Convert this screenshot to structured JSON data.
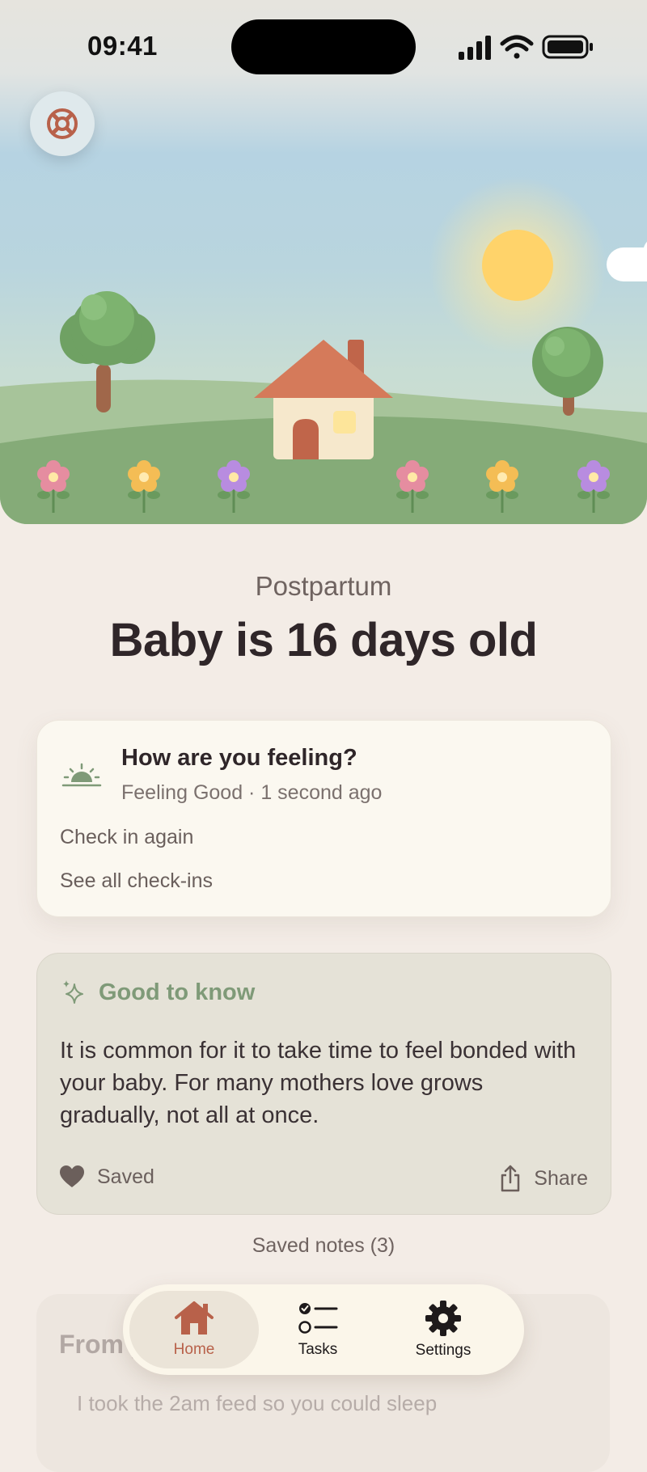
{
  "status_bar": {
    "time": "09:41"
  },
  "hero": {
    "help_label": "Help"
  },
  "header": {
    "phase": "Postpartum",
    "headline": "Baby is 16 days old"
  },
  "feeling_card": {
    "title": "How are you feeling?",
    "status": "Feeling Good · 1 second ago",
    "check_in_label": "Check in again",
    "see_all_label": "See all check-ins"
  },
  "tip_card": {
    "title": "Good to know",
    "body": "It is common for it to take time to feel bonded with your baby. For many mothers love grows gradually, not all at once.",
    "saved_label": "Saved",
    "share_label": "Share"
  },
  "saved_notes_label": "Saved notes (3)",
  "partner_card": {
    "title": "From your partner",
    "quote": "I took the 2am feed so you could sleep"
  },
  "tab_bar": {
    "tabs": [
      {
        "label": "Home",
        "selected": true
      },
      {
        "label": "Tasks",
        "selected": false
      },
      {
        "label": "Settings",
        "selected": false
      }
    ]
  },
  "colors": {
    "accent": "#b8614a",
    "tip_title": "#7f9a78",
    "background": "#f3ece6",
    "card": "#fbf8f0"
  }
}
